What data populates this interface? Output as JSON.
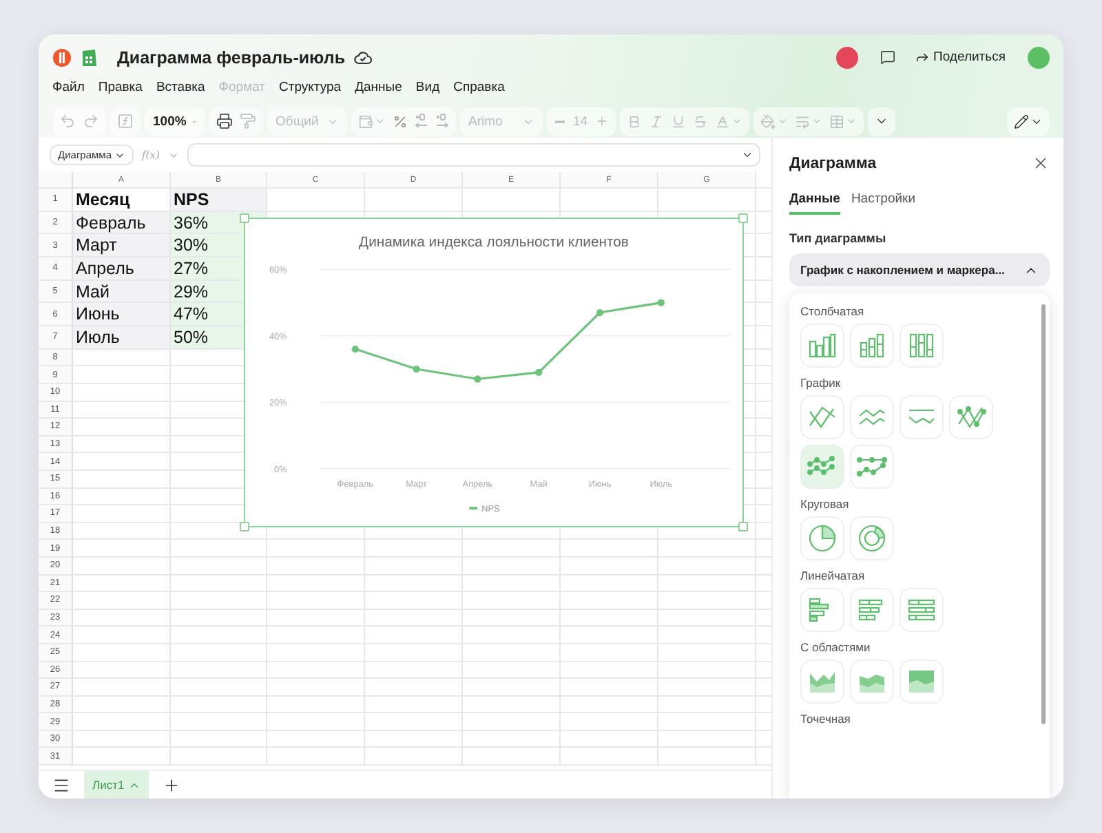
{
  "window": {
    "title": "Диаграмма февраль-июль"
  },
  "header": {
    "share_button": "Поделиться"
  },
  "menu": [
    {
      "label": "Файл",
      "disabled": false
    },
    {
      "label": "Правка",
      "disabled": false
    },
    {
      "label": "Вставка",
      "disabled": false
    },
    {
      "label": "Формат",
      "disabled": true
    },
    {
      "label": "Структура",
      "disabled": false
    },
    {
      "label": "Данные",
      "disabled": false
    },
    {
      "label": "Вид",
      "disabled": false
    },
    {
      "label": "Справка",
      "disabled": false
    }
  ],
  "toolbar": {
    "zoom": {
      "value": "100%",
      "disabled": false
    },
    "number_format": {
      "value": "Общий",
      "disabled": true
    },
    "font": {
      "value": "Arimo",
      "disabled": true
    },
    "font_size": {
      "value": "14",
      "disabled": true
    }
  },
  "formula_bar": {
    "name_box": "Диаграмма",
    "function_label": "f(x)"
  },
  "sheet": {
    "columns": [
      "A",
      "B",
      "C",
      "D",
      "E",
      "F",
      "G"
    ],
    "rows": [
      {
        "number": "1",
        "cells": [
          {
            "text": "Месяц",
            "bold": true,
            "shaded": false,
            "selected": false
          },
          {
            "text": "NPS",
            "bold": true,
            "shaded": true,
            "selected": false
          }
        ]
      },
      {
        "number": "2",
        "cells": [
          {
            "text": "Февраль",
            "bold": false,
            "shaded": true,
            "selected": false
          },
          {
            "text": "36%",
            "bold": false,
            "shaded": false,
            "selected": true
          }
        ]
      },
      {
        "number": "3",
        "cells": [
          {
            "text": "Март",
            "bold": false,
            "shaded": true,
            "selected": false
          },
          {
            "text": "30%",
            "bold": false,
            "shaded": false,
            "selected": true
          }
        ]
      },
      {
        "number": "4",
        "cells": [
          {
            "text": "Апрель",
            "bold": false,
            "shaded": true,
            "selected": false
          },
          {
            "text": "27%",
            "bold": false,
            "shaded": false,
            "selected": true
          }
        ]
      },
      {
        "number": "5",
        "cells": [
          {
            "text": "Май",
            "bold": false,
            "shaded": true,
            "selected": false
          },
          {
            "text": "29%",
            "bold": false,
            "shaded": false,
            "selected": true
          }
        ]
      },
      {
        "number": "6",
        "cells": [
          {
            "text": "Июнь",
            "bold": false,
            "shaded": true,
            "selected": false
          },
          {
            "text": "47%",
            "bold": false,
            "shaded": false,
            "selected": true
          }
        ]
      },
      {
        "number": "7",
        "cells": [
          {
            "text": "Июль",
            "bold": false,
            "shaded": true,
            "selected": false
          },
          {
            "text": "50%",
            "bold": false,
            "shaded": false,
            "selected": true
          }
        ]
      },
      {
        "number": "8"
      },
      {
        "number": "9"
      },
      {
        "number": "10"
      },
      {
        "number": "11"
      },
      {
        "number": "12"
      },
      {
        "number": "13"
      },
      {
        "number": "14"
      },
      {
        "number": "15"
      },
      {
        "number": "16"
      },
      {
        "number": "17"
      },
      {
        "number": "18"
      },
      {
        "number": "19"
      },
      {
        "number": "20"
      },
      {
        "number": "21"
      },
      {
        "number": "22"
      },
      {
        "number": "23"
      },
      {
        "number": "24"
      },
      {
        "number": "25"
      },
      {
        "number": "26"
      },
      {
        "number": "27"
      },
      {
        "number": "28"
      },
      {
        "number": "29"
      },
      {
        "number": "30"
      },
      {
        "number": "31"
      }
    ],
    "chart": {
      "chart_data": {
        "type": "line",
        "title": "Динамика индекса лояльности клиентов",
        "categories": [
          "Февраль",
          "Март",
          "Апрель",
          "Май",
          "Июнь",
          "Июль"
        ],
        "series": [
          {
            "name": "NPS",
            "color": "#6cc47a",
            "marker": true,
            "values": [
              36,
              30,
              27,
              29,
              47,
              50
            ]
          }
        ],
        "ylim": [
          0,
          60
        ],
        "yticks": [
          {
            "value": 0,
            "label": "0%"
          },
          {
            "value": 20,
            "label": "20%"
          },
          {
            "value": 40,
            "label": "40%"
          },
          {
            "value": 60,
            "label": "60%"
          }
        ]
      }
    }
  },
  "sheet_tabs": [
    {
      "label": "Лист1",
      "selected": true
    }
  ],
  "panel": {
    "title": "Диаграмма",
    "tabs": [
      {
        "label": "Данные",
        "selected": true
      },
      {
        "label": "Настройки",
        "selected": false
      }
    ],
    "chart_type_label": "Тип диаграммы",
    "chart_type_select": {
      "value": "График с накоплением и маркера...",
      "expanded": true
    },
    "groups": [
      {
        "label": "Столбчатая",
        "options": [
          {
            "kind": "column-clustered",
            "selected": false
          },
          {
            "kind": "column-stacked",
            "selected": false
          },
          {
            "kind": "column-stacked-100",
            "selected": false
          }
        ]
      },
      {
        "label": "График",
        "options": [
          {
            "kind": "line",
            "selected": false
          },
          {
            "kind": "line-stacked",
            "selected": false
          },
          {
            "kind": "line-stacked-100",
            "selected": false
          },
          {
            "kind": "line-markers",
            "selected": false
          },
          {
            "kind": "line-stacked-markers",
            "selected": true
          },
          {
            "kind": "line-stacked-100-markers",
            "selected": false
          }
        ]
      },
      {
        "label": "Круговая",
        "options": [
          {
            "kind": "pie",
            "selected": false
          },
          {
            "kind": "donut",
            "selected": false
          }
        ]
      },
      {
        "label": "Линейчатая",
        "options": [
          {
            "kind": "bar-clustered",
            "selected": false
          },
          {
            "kind": "bar-stacked",
            "selected": false
          },
          {
            "kind": "bar-stacked-100",
            "selected": false
          }
        ]
      },
      {
        "label": "С областями",
        "options": [
          {
            "kind": "area",
            "selected": false
          },
          {
            "kind": "area-stacked",
            "selected": false
          },
          {
            "kind": "area-stacked-100",
            "selected": false
          }
        ]
      },
      {
        "label": "Точечная"
      }
    ]
  }
}
